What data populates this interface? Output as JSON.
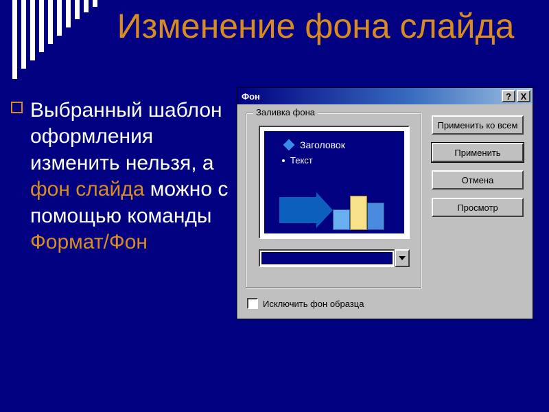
{
  "slide": {
    "title": "Изменение фона слайда",
    "bullet": {
      "part1": "Выбранный шаблон оформления изменить нельзя, а ",
      "hl1": "фон слайда",
      "part2": " можно с помощью команды ",
      "hl2": "Формат/Фон"
    }
  },
  "dialog": {
    "title": "Фон",
    "help": "?",
    "close": "X",
    "group_label": "Заливка фона",
    "preview": {
      "title": "Заголовок",
      "text": "Текст"
    },
    "buttons": {
      "apply_all": "Применить ко всем",
      "apply": "Применить",
      "cancel": "Отмена",
      "preview": "Просмотр"
    },
    "checkbox_label": "Исключить фон образца"
  }
}
